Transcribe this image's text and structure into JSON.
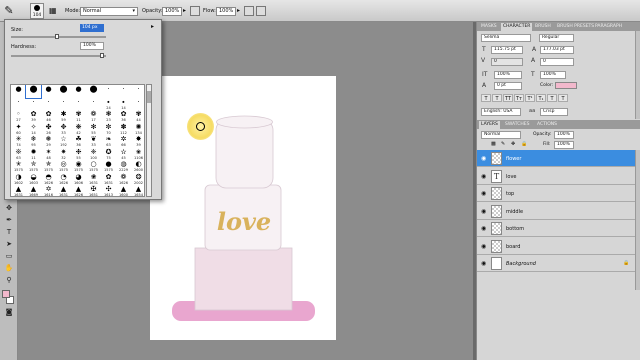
{
  "options_bar": {
    "brush_size": "104",
    "mode_label": "Mode:",
    "mode_value": "Normal",
    "opacity_label": "Opacity:",
    "opacity_value": "100%",
    "flow_label": "Flow:",
    "flow_value": "100%"
  },
  "brush_panel": {
    "size_label": "Size:",
    "size_value": "104 px",
    "hardness_label": "Hardness:",
    "hardness_value": "100%",
    "presets": [
      {
        "n": "",
        "g": "●"
      },
      {
        "n": "",
        "g": "⬤"
      },
      {
        "n": "",
        "g": "●"
      },
      {
        "n": "",
        "g": "⬤"
      },
      {
        "n": "",
        "g": "●"
      },
      {
        "n": "",
        "g": "⬤"
      },
      {
        "n": "",
        "g": "·"
      },
      {
        "n": "",
        "g": "·"
      },
      {
        "n": "",
        "g": "·"
      },
      {
        "n": "",
        "g": "·"
      },
      {
        "n": "",
        "g": "·"
      },
      {
        "n": "",
        "g": "·"
      },
      {
        "n": "",
        "g": "·"
      },
      {
        "n": "",
        "g": "·"
      },
      {
        "n": "",
        "g": "·"
      },
      {
        "n": "24",
        "g": "∙"
      },
      {
        "n": "14",
        "g": "∙"
      },
      {
        "n": "",
        "g": "·"
      },
      {
        "n": "27",
        "g": "◦"
      },
      {
        "n": "39",
        "g": "✿"
      },
      {
        "n": "46",
        "g": "✿"
      },
      {
        "n": "59",
        "g": "✱"
      },
      {
        "n": "11",
        "g": "✾"
      },
      {
        "n": "17",
        "g": "❁"
      },
      {
        "n": "23",
        "g": "❃"
      },
      {
        "n": "36",
        "g": "✿"
      },
      {
        "n": "44",
        "g": "✾"
      },
      {
        "n": "60",
        "g": "✦"
      },
      {
        "n": "14",
        "g": "✧"
      },
      {
        "n": "26",
        "g": "✤"
      },
      {
        "n": "33",
        "g": "✥"
      },
      {
        "n": "42",
        "g": "❋"
      },
      {
        "n": "55",
        "g": "✻"
      },
      {
        "n": "70",
        "g": "✼"
      },
      {
        "n": "112",
        "g": "✽"
      },
      {
        "n": "134",
        "g": "✺"
      },
      {
        "n": "74",
        "g": "✳"
      },
      {
        "n": "95",
        "g": "❄"
      },
      {
        "n": "29",
        "g": "❅"
      },
      {
        "n": "192",
        "g": "☆"
      },
      {
        "n": "36",
        "g": "☘"
      },
      {
        "n": "33",
        "g": "❦"
      },
      {
        "n": "63",
        "g": "❧"
      },
      {
        "n": "66",
        "g": "✲"
      },
      {
        "n": "39",
        "g": "✸"
      },
      {
        "n": "63",
        "g": "❊"
      },
      {
        "n": "11",
        "g": "✹"
      },
      {
        "n": "48",
        "g": "✶"
      },
      {
        "n": "32",
        "g": "✷"
      },
      {
        "n": "55",
        "g": "❉"
      },
      {
        "n": "100",
        "g": "❈"
      },
      {
        "n": "75",
        "g": "✪"
      },
      {
        "n": "45",
        "g": "✫"
      },
      {
        "n": "1106",
        "g": "✬"
      },
      {
        "n": "1575",
        "g": "✭"
      },
      {
        "n": "1575",
        "g": "✮"
      },
      {
        "n": "1575",
        "g": "✯"
      },
      {
        "n": "1575",
        "g": "◎"
      },
      {
        "n": "1575",
        "g": "◉"
      },
      {
        "n": "1575",
        "g": "○"
      },
      {
        "n": "1575",
        "g": "●"
      },
      {
        "n": "2229",
        "g": "◍"
      },
      {
        "n": "2600",
        "g": "◐"
      },
      {
        "n": "1602",
        "g": "◑"
      },
      {
        "n": "1603",
        "g": "◒"
      },
      {
        "n": "1626",
        "g": "◓"
      },
      {
        "n": "1626",
        "g": "◔"
      },
      {
        "n": "1606",
        "g": "◕"
      },
      {
        "n": "1631",
        "g": "❀"
      },
      {
        "n": "1631",
        "g": "✿"
      },
      {
        "n": "1626",
        "g": "❁"
      },
      {
        "n": "2002",
        "g": "❂"
      },
      {
        "n": "1631",
        "g": "▲"
      },
      {
        "n": "1669",
        "g": "▲"
      },
      {
        "n": "1616",
        "g": "✡"
      },
      {
        "n": "1631",
        "g": "▲"
      },
      {
        "n": "1626",
        "g": "▲"
      },
      {
        "n": "1651",
        "g": "✠"
      },
      {
        "n": "1613",
        "g": "✣"
      },
      {
        "n": "1600",
        "g": "▲"
      },
      {
        "n": "1654",
        "g": "▲"
      }
    ]
  },
  "character_panel": {
    "tabs": [
      "MASKS",
      "CHARACTER",
      "BRUSH",
      "BRUSH PRESETS",
      "PARAGRAPH"
    ],
    "font_family": "Selima",
    "font_style": "Regular",
    "font_size": "115.75 pt",
    "leading": "177.03 pt",
    "kerning": "0",
    "tracking": "0",
    "vertical_scale": "100%",
    "horizontal_scale": "100%",
    "baseline_shift": "0 pt",
    "color_label": "Color:",
    "color_value": "#f2b8cc",
    "language": "English: USA",
    "antialias": "Crisp"
  },
  "layers_panel": {
    "tabs": [
      "LAYERS",
      "SWATCHES",
      "ACTIONS"
    ],
    "blend_mode": "Normal",
    "opacity_label": "Opacity:",
    "opacity_value": "100%",
    "fill_label": "Fill:",
    "fill_value": "100%",
    "layers": [
      {
        "name": "flower",
        "kind": "pixel"
      },
      {
        "name": "love",
        "kind": "text"
      },
      {
        "name": "top",
        "kind": "pixel"
      },
      {
        "name": "middle",
        "kind": "pixel"
      },
      {
        "name": "bottom",
        "kind": "pixel"
      },
      {
        "name": "board",
        "kind": "pixel"
      },
      {
        "name": "Background",
        "kind": "background"
      }
    ]
  },
  "canvas": {
    "cake_text": "love",
    "colors": {
      "board": "#e9a6cf",
      "tier_fill": "#f7f1f4",
      "tier_bottom": "#f0dde6",
      "tier_stroke": "#d8c9d2",
      "text_gold": "#d9b25c",
      "selection": "#3b8de0"
    }
  }
}
